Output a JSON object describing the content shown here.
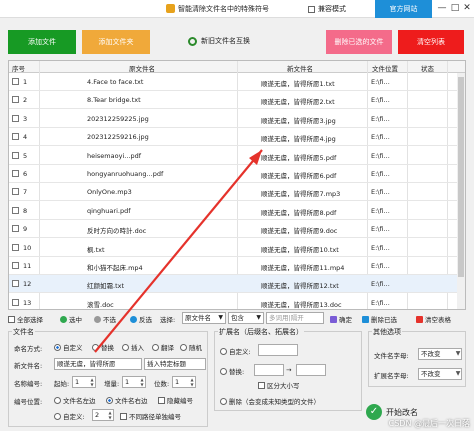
{
  "titlebar": {
    "title": "智能清除文件名中的特殊符号",
    "compat_mode": "兼容模式",
    "official_site": "官方网站",
    "min": "—",
    "max": "□",
    "close": "✕"
  },
  "toolbar": {
    "add_file": "添加文件",
    "add_folder": "添加文件夹",
    "swap_names": "新旧文件名互换",
    "delete_selected": "删除已选的文件",
    "clear_list": "清空列表"
  },
  "colors": {
    "green": "#179a24",
    "orange": "#f0a93a",
    "pink": "#f46b8a",
    "red": "#ee1c1c",
    "blue": "#1e8fd8",
    "arrow": "#e5322b"
  },
  "table": {
    "headers": [
      "序号",
      "原文件名",
      "新文件名",
      "文件位置",
      "状态"
    ],
    "rows": [
      {
        "no": "1",
        "orig": "4.Face to face.txt",
        "new": "顺遂无虞，皆得所愿1.txt",
        "loc": "E:\\fi..."
      },
      {
        "no": "2",
        "orig": "8.Tear bridge.txt",
        "new": "顺遂无虞，皆得所愿2.txt",
        "loc": "E:\\fi..."
      },
      {
        "no": "3",
        "orig": "202312259225.jpg",
        "new": "顺遂无虞，皆得所愿3.jpg",
        "loc": "E:\\fi..."
      },
      {
        "no": "4",
        "orig": "202312259216.jpg",
        "new": "顺遂无虞，皆得所愿4.jpg",
        "loc": "E:\\fi..."
      },
      {
        "no": "5",
        "orig": "heisemaoyi...pdf",
        "new": "顺遂无虞，皆得所愿5.pdf",
        "loc": "E:\\fi..."
      },
      {
        "no": "6",
        "orig": "hongyanruohuang...pdf",
        "new": "顺遂无虞，皆得所愿6.pdf",
        "loc": "E:\\fi..."
      },
      {
        "no": "7",
        "orig": "OnlyOne.mp3",
        "new": "顺遂无虞，皆得所愿7.mp3",
        "loc": "E:\\fi..."
      },
      {
        "no": "8",
        "orig": "qinghuari.pdf",
        "new": "顺遂无虞，皆得所愿8.pdf",
        "loc": "E:\\fi..."
      },
      {
        "no": "9",
        "orig": "反时方向の時計.doc",
        "new": "顺遂无虞，皆得所愿9.doc",
        "loc": "E:\\fi..."
      },
      {
        "no": "10",
        "orig": "枫.txt",
        "new": "顺遂无虞，皆得所愿10.txt",
        "loc": "E:\\fi..."
      },
      {
        "no": "11",
        "orig": "和小猫不起床.mp4",
        "new": "顺遂无虞，皆得所愿11.mp4",
        "loc": "E:\\fi..."
      },
      {
        "no": "12",
        "orig": "红颜如霜.txt",
        "new": "顺遂无虞，皆得所愿12.txt",
        "loc": "E:\\fi..."
      },
      {
        "no": "13",
        "orig": "滚雪.doc",
        "new": "顺遂无虞，皆得所愿13.doc",
        "loc": "E:\\fi..."
      }
    ]
  },
  "controls": {
    "select_all": "全部选择",
    "select": "选中",
    "deselect": "不选",
    "invert": "反选",
    "choose": "选择:",
    "orig_name": "原文件名",
    "contains": "包含",
    "search_placeholder": "多词用|隔开",
    "confirm": "确定",
    "delete_selected": "删除已选",
    "clear_table": "清空表格"
  },
  "filename_panel": {
    "group": "文件名",
    "naming_mode": "命名方式:",
    "custom": "自定义",
    "replace": "替换",
    "insert": "插入",
    "flip": "翻译",
    "random": "随机",
    "new_name_label": "新文件名:",
    "new_name_value": "顺遂无虞，皆得所愿",
    "insert_title": "插入特定标题",
    "numbering": "名称编号:",
    "start": "起始:",
    "start_val": "1",
    "step": "增量:",
    "step_val": "1",
    "digits": "位数:",
    "digits_val": "1",
    "position": "编号位置:",
    "pos_left": "文件名左边",
    "pos_right": "文件名右边",
    "hide_number": "隐藏编号",
    "pos_custom": "自定义:",
    "custom_val": "2",
    "no_dup": "不同路径单独编号"
  },
  "ext_panel": {
    "group": "扩展名（后缀名、拓展名）",
    "custom": "自定义:",
    "replace": "替换:",
    "case_sensitive": "区分大小写",
    "delete": "删除（会变成未知类型的文件）"
  },
  "other_panel": {
    "group": "其他选项",
    "name_case": "文件名字母:",
    "name_case_val": "不改变",
    "ext_case": "扩展名字母:",
    "ext_case_val": "不改变"
  },
  "start_rename": "开始改名",
  "watermark": "CSDN @最后一次日落"
}
